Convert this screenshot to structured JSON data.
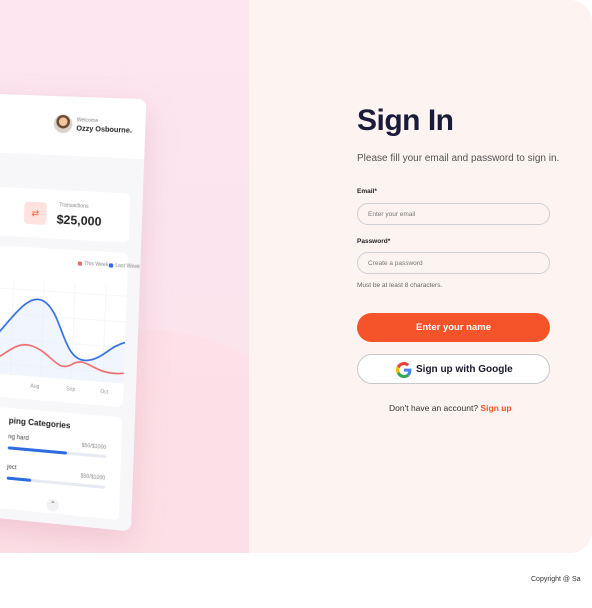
{
  "colors": {
    "accent": "#f5542a",
    "hero_bg": "#fde6ef",
    "panel_bg": "#fdf3f1",
    "series_this_week": "#ec6a6a",
    "series_last_week": "#2d6be0"
  },
  "dashboard_preview": {
    "welcome_label": "Welcome",
    "user_name": "Ozzy Osbourne",
    "transactions": {
      "label": "Transactions",
      "value": "$25,000",
      "icon": "swap-icon"
    },
    "chart": {
      "legend": [
        "This Week",
        "Last Week"
      ],
      "x_labels": [
        "Aug",
        "Sep",
        "Oct"
      ]
    },
    "categories": {
      "title": "ping Categories",
      "items": [
        {
          "name": "ng hard",
          "amount": "$50/$1000",
          "progress": 0.6
        },
        {
          "name": "ject",
          "amount": "$50/$1000",
          "progress": 0.25
        }
      ]
    }
  },
  "signin": {
    "title": "Sign In",
    "subtitle": "Please fill your email and password to sign in.",
    "email_label": "Email*",
    "email_placeholder": "Enter your email",
    "password_label": "Password*",
    "password_placeholder": "Create a password",
    "password_hint": "Must be at least 8 characters.",
    "primary_button": "Enter your name",
    "google_button": "Sign up with Google",
    "no_account_text": "Don't have an account?",
    "signup_link": "Sign up"
  },
  "footer": {
    "copyright": "Copyright @ Sa"
  }
}
